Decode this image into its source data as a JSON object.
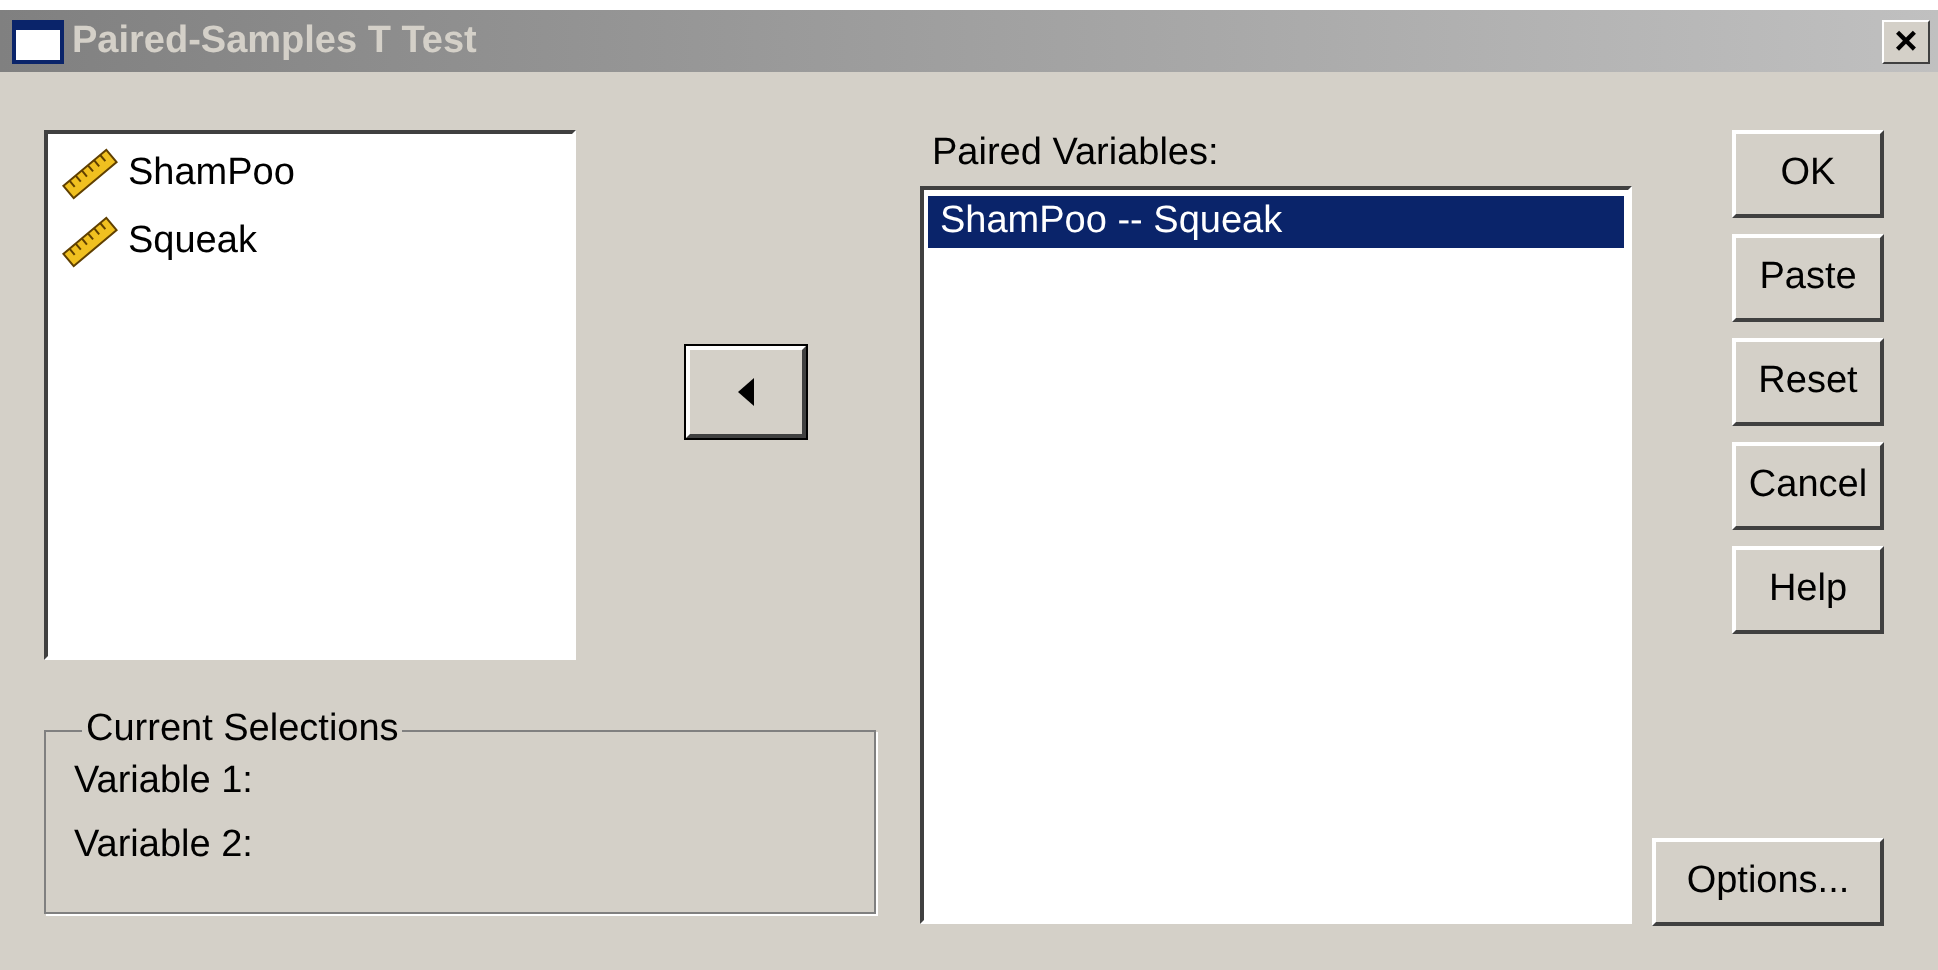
{
  "window": {
    "title": "Paired-Samples T Test",
    "close": "×"
  },
  "variables": [
    {
      "name": "ShamPoo",
      "selected": false
    },
    {
      "name": "Squeak",
      "selected": false
    }
  ],
  "current_selections": {
    "title": "Current Selections",
    "rows": [
      "Variable 1:",
      "Variable 2:"
    ]
  },
  "paired_variables": {
    "label": "Paired Variables:",
    "items": [
      {
        "name": "ShamPoo -- Squeak",
        "selected": true
      }
    ]
  },
  "buttons": [
    "OK",
    "Paste",
    "Reset",
    "Cancel",
    "Help"
  ],
  "options_button": "Options..."
}
